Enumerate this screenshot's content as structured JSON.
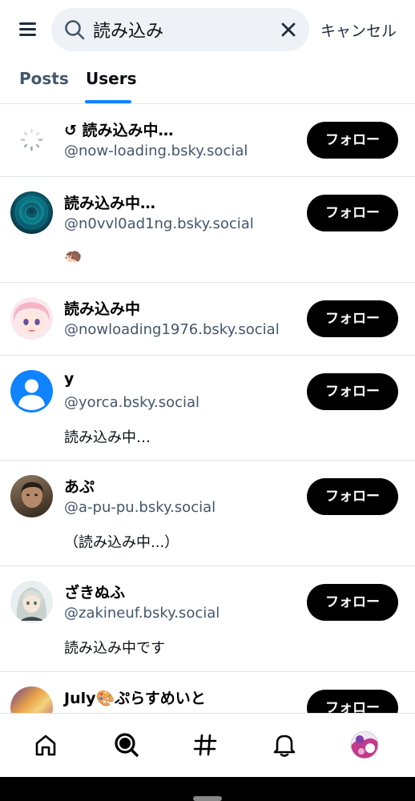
{
  "search": {
    "value": "読み込み",
    "cancel_label": "キャンセル"
  },
  "tabs": [
    {
      "label": "Posts",
      "active": false
    },
    {
      "label": "Users",
      "active": true
    }
  ],
  "accent_color": "#1083fe",
  "users": [
    {
      "display_name": "↺ 読み込み中…",
      "handle": "@now-loading.bsky.social",
      "bio": "",
      "follow_label": "フォロー"
    },
    {
      "display_name": "読み込み中…",
      "handle": "@n0vvl0ad1ng.bsky.social",
      "bio": "🦔",
      "follow_label": "フォロー"
    },
    {
      "display_name": "読み込み中",
      "handle": "@nowloading1976.bsky.social",
      "bio": "",
      "follow_label": "フォロー"
    },
    {
      "display_name": "y",
      "handle": "@yorca.bsky.social",
      "bio": "読み込み中…",
      "follow_label": "フォロー"
    },
    {
      "display_name": "あぷ",
      "handle": "@a-pu-pu.bsky.social",
      "bio": "（読み込み中...）",
      "follow_label": "フォロー"
    },
    {
      "display_name": "ざきぬふ",
      "handle": "@zakineuf.bsky.social",
      "bio": "読み込み中です",
      "follow_label": "フォロー"
    },
    {
      "display_name": "July🎨ぷらすめいと",
      "handle": "",
      "bio": "",
      "follow_label": "フォロー"
    }
  ],
  "bottom_nav": [
    "home-icon",
    "search-icon",
    "hashtag-icon",
    "notifications-icon",
    "profile-avatar"
  ]
}
